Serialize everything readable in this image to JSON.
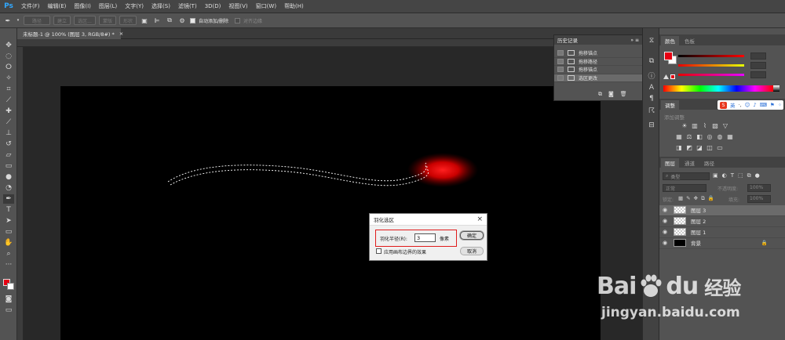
{
  "app": {
    "logo": "Ps"
  },
  "menu": [
    "文件(F)",
    "编辑(E)",
    "图像(I)",
    "图层(L)",
    "文字(Y)",
    "选择(S)",
    "滤镜(T)",
    "3D(D)",
    "视图(V)",
    "窗口(W)",
    "帮助(H)"
  ],
  "options_bar": {
    "path_btn": "路径",
    "btn2": "建立",
    "btn3": "选区...",
    "btn4": "蒙版",
    "btn5": "形状",
    "auto_add_delete": "自动添加/删除",
    "auto_add_delete_checked": true,
    "align_edges": "对齐边缘",
    "align_edges_checked": false
  },
  "document": {
    "tab_title": "未标题-1 @ 100% (图层 3, RGB/8#) *",
    "close": "×"
  },
  "history": {
    "title": "历史记录",
    "items": [
      "拖移锚点",
      "拖移路径",
      "拖移锚点",
      "选区更改"
    ],
    "selected_index": 3
  },
  "color_panel": {
    "tabs": [
      "颜色",
      "色板"
    ],
    "fg_color": "#e60012",
    "bg_color": "#ffffff"
  },
  "adjustments": {
    "title": "调整",
    "subtitle": "添加调整"
  },
  "layers": {
    "tabs": [
      "图层",
      "通道",
      "路径"
    ],
    "search_placeholder": "类型",
    "blend_mode": "正常",
    "opacity_label": "不透明度:",
    "opacity_value": "100%",
    "lock_label": "锁定:",
    "fill_label": "填充:",
    "fill_value": "100%",
    "items": [
      {
        "name": "图层 3",
        "selected": true,
        "thumb": "transparent"
      },
      {
        "name": "图层 2",
        "selected": false,
        "thumb": "transparent"
      },
      {
        "name": "图层 1",
        "selected": false,
        "thumb": "transparent"
      },
      {
        "name": "背景",
        "selected": false,
        "thumb": "black"
      }
    ]
  },
  "dialog": {
    "title": "羽化选区",
    "close": "×",
    "radius_label": "羽化半径(R):",
    "radius_value": "3",
    "unit": "像素",
    "ok": "确定",
    "cancel": "取消",
    "checkbox_label": "应用画布边界的效果",
    "checkbox_checked": false
  },
  "ime": {
    "label": "英"
  },
  "watermark": {
    "brand": "Bai",
    "brand2": "du",
    "suffix": "经验",
    "url": "jingyan.baidu.com"
  },
  "colors": {
    "highlight_box": "#e01b1b",
    "glow": "#ff1010"
  }
}
